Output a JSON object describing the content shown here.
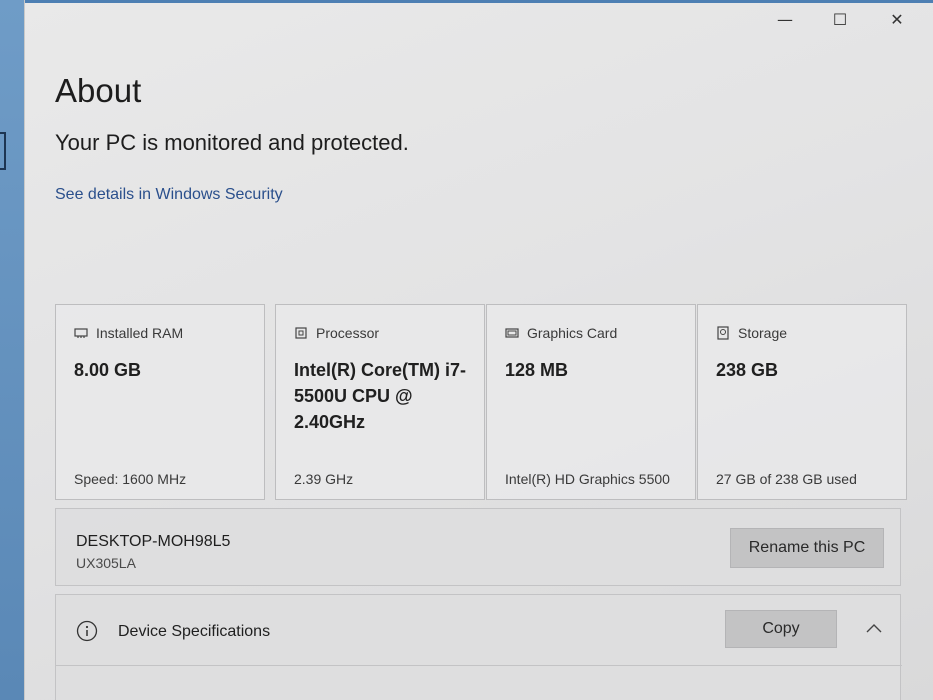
{
  "window": {
    "minimize": "—",
    "maximize": "☐",
    "close": "✕"
  },
  "page": {
    "title": "About",
    "status": "Your PC is monitored and protected.",
    "security_link": "See details in Windows Security"
  },
  "cards": [
    {
      "label": "Installed RAM",
      "value": "8.00 GB",
      "detail": "Speed: 1600 MHz",
      "icon": "ram-icon"
    },
    {
      "label": "Processor",
      "value": "Intel(R) Core(TM) i7-5500U CPU @ 2.40GHz",
      "detail": "2.39 GHz",
      "icon": "processor-icon"
    },
    {
      "label": "Graphics Card",
      "value": "128 MB",
      "detail": "Intel(R) HD Graphics 5500",
      "icon": "graphics-card-icon"
    },
    {
      "label": "Storage",
      "value": "238 GB",
      "detail": "27 GB of 238 GB used",
      "icon": "storage-icon"
    }
  ],
  "device": {
    "name": "DESKTOP-MOH98L5",
    "model": "UX305LA",
    "rename_label": "Rename this PC"
  },
  "specs": {
    "title": "Device Specifications",
    "copy_label": "Copy",
    "icons": [
      "info-icon",
      "chevron-up-icon"
    ]
  }
}
